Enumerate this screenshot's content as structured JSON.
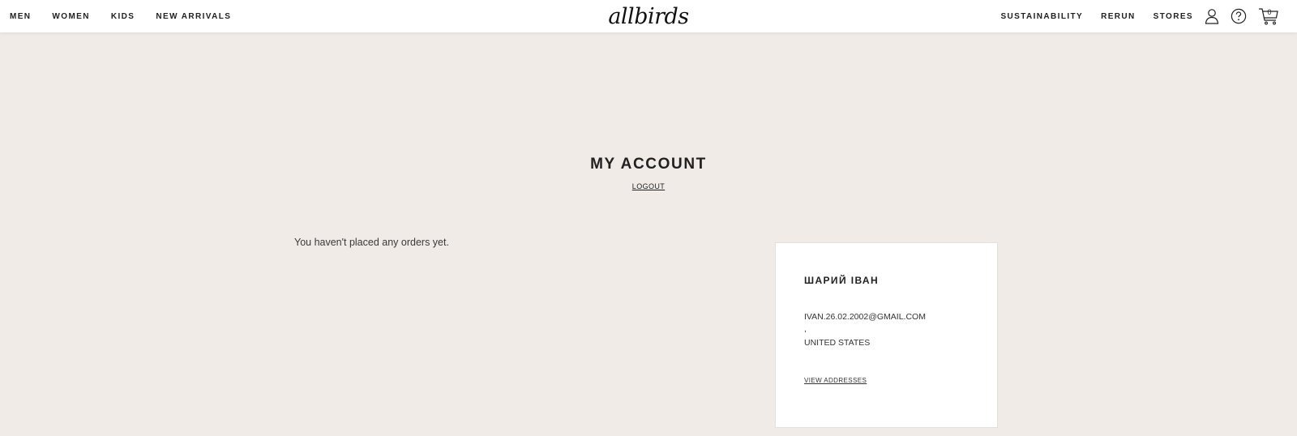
{
  "header": {
    "nav_left": [
      "MEN",
      "WOMEN",
      "KIDS",
      "NEW ARRIVALS"
    ],
    "nav_right": [
      "SUSTAINABILITY",
      "RERUN",
      "STORES"
    ],
    "logo_text": "allbirds",
    "cart_count": "0",
    "icons": [
      "account-icon",
      "help-icon",
      "cart-icon"
    ]
  },
  "page": {
    "title": "MY ACCOUNT",
    "logout_label": "LOGOUT"
  },
  "orders": {
    "empty_message": "You haven't placed any orders yet."
  },
  "account_card": {
    "name": "ШАРИЙ ІВАН",
    "email": "IVAN.26.02.2002@GMAIL.COM",
    "address_line": ",",
    "country": "UNITED STATES",
    "view_addresses_label": "VIEW ADDRESSES"
  }
}
